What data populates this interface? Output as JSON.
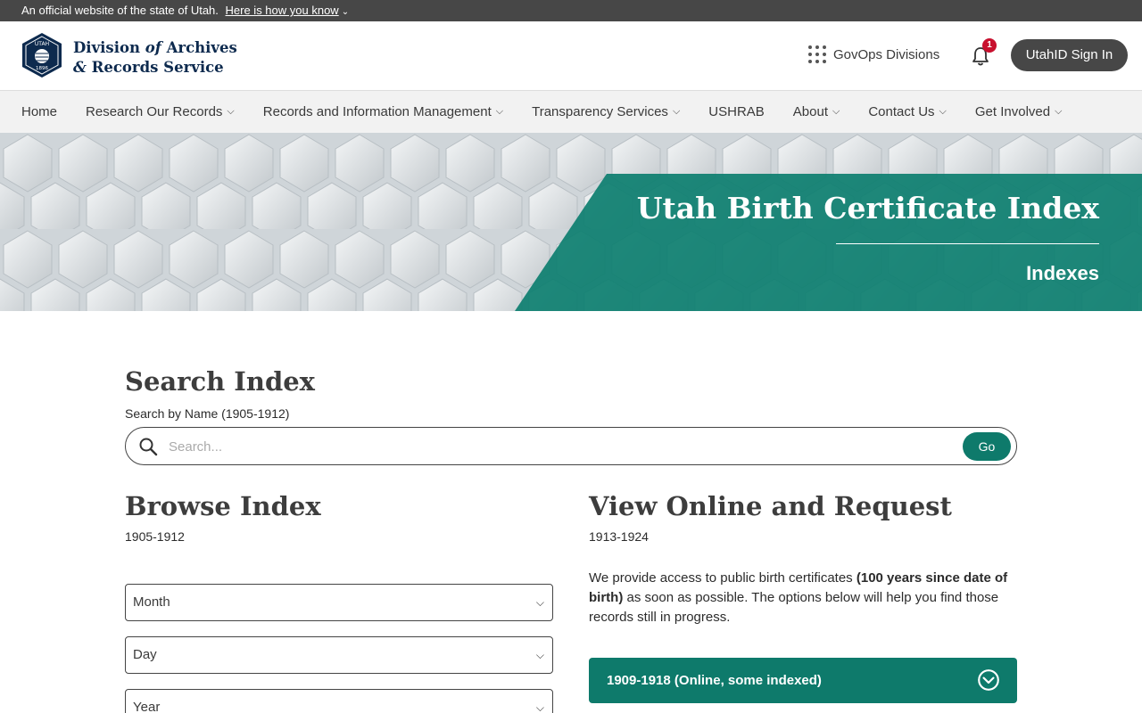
{
  "official_bar": {
    "text": "An official website of the state of Utah.",
    "link": "Here is how you know"
  },
  "header": {
    "brand_line1_a": "Division ",
    "brand_line1_b": "of",
    "brand_line1_c": " Archives",
    "brand_line2_a": "&",
    "brand_line2_b": " Records Service",
    "logo_top": "UTAH",
    "logo_bottom": "1896",
    "govops": "GovOps Divisions",
    "notification_count": "1",
    "signin": "UtahID Sign In"
  },
  "nav": {
    "items": [
      {
        "label": "Home"
      },
      {
        "label": "Research Our Records"
      },
      {
        "label": "Records and Information Management"
      },
      {
        "label": "Transparency Services"
      },
      {
        "label": "USHRAB"
      },
      {
        "label": "About"
      },
      {
        "label": "Contact Us"
      },
      {
        "label": "Get Involved"
      }
    ]
  },
  "hero": {
    "title": "Utah Birth Certificate Index",
    "subtitle": "Indexes"
  },
  "search": {
    "heading": "Search Index",
    "label": "Search by Name (1905-1912)",
    "placeholder": "Search...",
    "go": "Go"
  },
  "browse": {
    "heading": "Browse Index",
    "range": "1905-1912",
    "selects": [
      {
        "value": "Month"
      },
      {
        "value": "Day"
      },
      {
        "value": "Year"
      }
    ]
  },
  "view": {
    "heading": "View Online and Request",
    "range": "1913-1924",
    "para_a": "We provide access to public birth certificates ",
    "para_b": "(100 years since date of birth)",
    "para_c": " as soon as possible. The options below will help you find those records still in progress.",
    "accordion": "1909-1918 (Online, some indexed)"
  },
  "colors": {
    "accent": "#0e7a6b",
    "dark": "#474747",
    "brand": "#0d2a4e",
    "badge": "#c8102e"
  },
  "icons": [
    "chevron-down-icon",
    "grid-dots-icon",
    "bell-icon",
    "search-icon",
    "utah-seal-logo",
    "circle-chevron-icon"
  ]
}
